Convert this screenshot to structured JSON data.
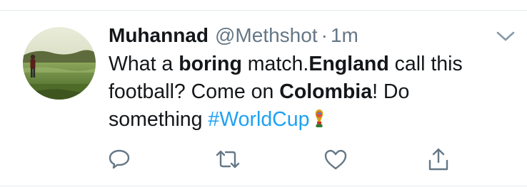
{
  "tweet": {
    "author": {
      "display_name": "Muhannad",
      "handle": "@Methshot"
    },
    "separator": "·",
    "timestamp": "1m",
    "text": {
      "line1": {
        "a": "What a ",
        "b_bold": "boring",
        "c": " match.",
        "d_bold": "England",
        "e": " call this"
      },
      "line2": {
        "a": "football? Come on ",
        "b_bold": "Colombia",
        "c": "! Do"
      },
      "line3": {
        "a": "something ",
        "hashtag": "#WorldCup"
      }
    }
  },
  "icons": {
    "caret": "chevron-down-icon",
    "reply": "reply-icon",
    "retweet": "retweet-icon",
    "like": "heart-icon",
    "share": "share-icon",
    "hashtag_emoji": "world-cup-trophy-icon"
  },
  "colors": {
    "text": "#14171a",
    "secondary": "#657786",
    "link": "#1da1f2",
    "divider": "#e6ecf0"
  }
}
